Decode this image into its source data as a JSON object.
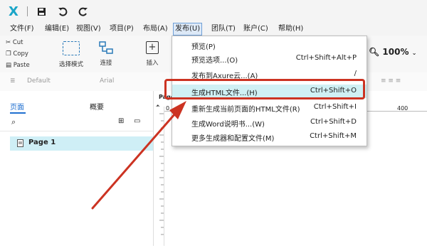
{
  "titlebar": {
    "logo_glyph": "X",
    "icons": [
      "app-logo-icon",
      "save-icon",
      "undo-icon",
      "redo-icon"
    ]
  },
  "menubar": {
    "items": [
      {
        "label": "文件(F)"
      },
      {
        "label": "编辑(E)"
      },
      {
        "label": "视图(V)"
      },
      {
        "label": "项目(P)"
      },
      {
        "label": "布局(A)"
      },
      {
        "label": "发布(U)"
      },
      {
        "label": "团队(T)"
      },
      {
        "label": "账户(C)"
      },
      {
        "label": "帮助(H)"
      }
    ],
    "active_index": 5
  },
  "toolbar": {
    "cut": "Cut",
    "copy": "Copy",
    "paste": "Paste",
    "select_mode": "选择模式",
    "connect": "连接",
    "insert": "插入",
    "zoom": "100%"
  },
  "formatbar": {
    "style_value": "Default",
    "font_value": "Arial"
  },
  "leftpane": {
    "tabs": [
      "页面",
      "概要"
    ],
    "page_item": "Page 1"
  },
  "ruler": {
    "label_400": "400",
    "label_0": "0",
    "page_tab": "Page"
  },
  "dropdown": {
    "items": [
      {
        "label": "预览(P)",
        "shortcut": ""
      },
      {
        "label": "预览选项...(O)",
        "shortcut": "Ctrl+Shift+Alt+P"
      },
      {
        "label": "发布到Axure云...(A)",
        "shortcut": "/"
      },
      {
        "label": "生成HTML文件...(H)",
        "shortcut": "Ctrl+Shift+O"
      },
      {
        "label": "重新生成当前页面的HTML文件(R)",
        "shortcut": "Ctrl+Shift+I"
      },
      {
        "label": "生成Word说明书...(W)",
        "shortcut": "Ctrl+Shift+D"
      },
      {
        "label": "更多生成器和配置文件(M)",
        "shortcut": "Ctrl+Shift+M"
      }
    ],
    "highlight_index": 3
  },
  "colors": {
    "accent": "#1f6fd0",
    "highlight_row": "#d0f0f4",
    "annotation_red": "#cc3322",
    "logo": "#1aa5c8"
  }
}
